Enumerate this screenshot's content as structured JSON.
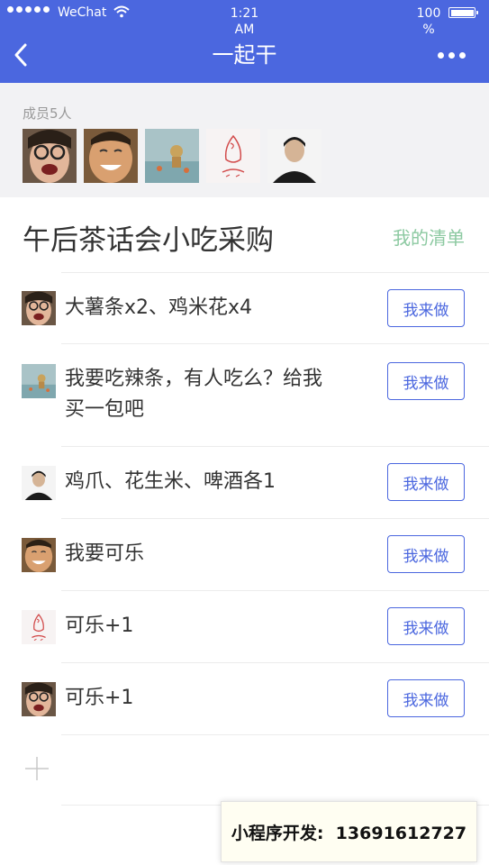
{
  "status_bar": {
    "carrier": "WeChat",
    "time": "1:21 AM",
    "battery": "100 %"
  },
  "nav": {
    "title": "一起干"
  },
  "members": {
    "label": "成员5人"
  },
  "list": {
    "title": "午后茶话会小吃采购",
    "my_list_link": "我的清单",
    "action_label": "我来做",
    "items": [
      {
        "text": "大薯条x2、鸡米花x4"
      },
      {
        "text": "我要吃辣条，有人吃么？给我买一包吧"
      },
      {
        "text": "鸡爪、花生米、啤酒各1"
      },
      {
        "text": "我要可乐"
      },
      {
        "text": "可乐+1"
      },
      {
        "text": "可乐+1"
      }
    ]
  },
  "promo": {
    "text": "小程序开发:  13691612727"
  },
  "colors": {
    "accent": "#4b67df",
    "link_green": "#8cc9a1",
    "members_bg": "#f2f2f4"
  }
}
